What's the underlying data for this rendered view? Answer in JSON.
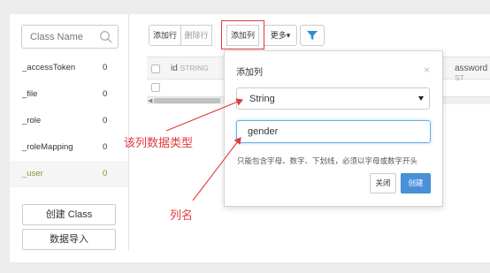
{
  "sidebar": {
    "search_placeholder": "Class Name",
    "classes": [
      {
        "name": "_accessToken",
        "count": "0"
      },
      {
        "name": "_file",
        "count": "0"
      },
      {
        "name": "_role",
        "count": "0"
      },
      {
        "name": "_roleMapping",
        "count": "0"
      },
      {
        "name": "_user",
        "count": "0"
      }
    ],
    "create_class_label": "创建 Class",
    "import_data_label": "数据导入"
  },
  "toolbar": {
    "add_row_label": "添加行",
    "delete_row_label": "删除行",
    "add_column_label": "添加列",
    "more_label": "更多",
    "more_caret": "▾"
  },
  "grid": {
    "columns": [
      {
        "name": "id",
        "type": "STRING"
      },
      {
        "name": "password",
        "type": "ST"
      }
    ],
    "partial_column_text": "assword",
    "scroll_left_glyph": "◀"
  },
  "add_column_popover": {
    "title": "添加列",
    "close_glyph": "×",
    "type_value": "String",
    "name_value": "gender",
    "hint": "只能包含字母、数字、下划线，必须以字母或数字开头",
    "close_button_label": "关闭",
    "create_button_label": "创建"
  },
  "annotations": {
    "type_label": "该列数据类型",
    "name_label": "列名"
  },
  "colors": {
    "accent_blue": "#4a90d9",
    "annotation_red": "#e23a3a",
    "active_class_green": "#7a9a3c",
    "filter_blue": "#2a8ad4"
  }
}
